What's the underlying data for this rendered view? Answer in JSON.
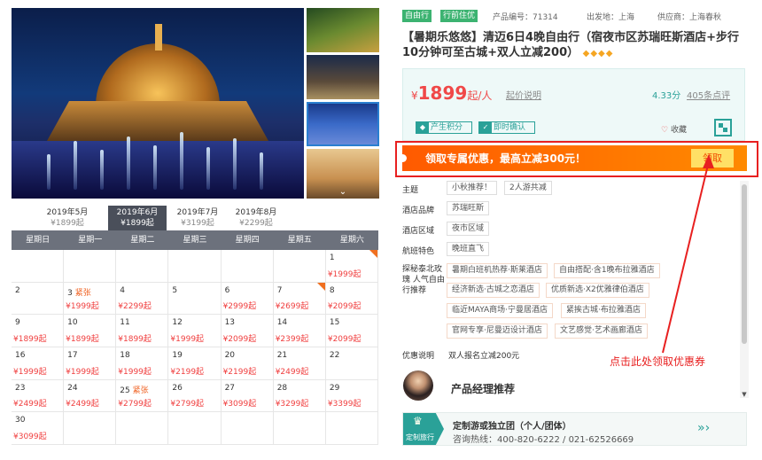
{
  "gallery": {
    "main_image": "resort-night-fountain-photo",
    "thumbnails": [
      "garden-pavilion-photo",
      "night-street-photo",
      "blue-night-palace-photo",
      "temple-pagoda-photo"
    ],
    "scroll_icon": "chevron-down-icon"
  },
  "calendar": {
    "months": [
      {
        "label": "2019年5月",
        "price": "¥1899起",
        "active": false
      },
      {
        "label": "2019年6月",
        "price": "¥1899起",
        "active": true
      },
      {
        "label": "2019年7月",
        "price": "¥3199起",
        "active": false
      },
      {
        "label": "2019年8月",
        "price": "¥2299起",
        "active": false
      }
    ],
    "weekdays": [
      "星期日",
      "星期一",
      "星期二",
      "星期三",
      "星期四",
      "星期五",
      "星期六"
    ],
    "weeks": [
      [
        null,
        null,
        null,
        null,
        null,
        null,
        {
          "day": "1",
          "price": "¥1999起",
          "corner": true
        }
      ],
      [
        {
          "day": "2",
          "price": ""
        },
        {
          "day": "3",
          "tag": "紧张",
          "price": "¥1999起"
        },
        {
          "day": "4",
          "price": "¥2299起"
        },
        {
          "day": "5",
          "price": ""
        },
        {
          "day": "6",
          "price": "¥2999起"
        },
        {
          "day": "7",
          "price": "¥2699起",
          "corner": true
        },
        {
          "day": "8",
          "price": "¥2099起"
        }
      ],
      [
        {
          "day": "9",
          "price": "¥1899起"
        },
        {
          "day": "10",
          "price": "¥1899起"
        },
        {
          "day": "11",
          "price": "¥1899起"
        },
        {
          "day": "12",
          "price": "¥1999起"
        },
        {
          "day": "13",
          "price": "¥2099起"
        },
        {
          "day": "14",
          "price": "¥2399起"
        },
        {
          "day": "15",
          "price": "¥2099起"
        }
      ],
      [
        {
          "day": "16",
          "price": "¥1999起"
        },
        {
          "day": "17",
          "price": "¥1999起"
        },
        {
          "day": "18",
          "price": "¥1999起"
        },
        {
          "day": "19",
          "price": "¥2199起"
        },
        {
          "day": "20",
          "price": "¥2199起"
        },
        {
          "day": "21",
          "price": "¥2499起"
        },
        {
          "day": "22",
          "price": ""
        }
      ],
      [
        {
          "day": "23",
          "price": "¥2499起"
        },
        {
          "day": "24",
          "price": "¥2499起"
        },
        {
          "day": "25",
          "tag": "紧张",
          "price": "¥2799起"
        },
        {
          "day": "26",
          "price": "¥2799起"
        },
        {
          "day": "27",
          "price": "¥3099起"
        },
        {
          "day": "28",
          "price": "¥3299起"
        },
        {
          "day": "29",
          "price": "¥3399起"
        }
      ],
      [
        {
          "day": "30",
          "price": "¥3099起"
        },
        null,
        null,
        null,
        null,
        null,
        null
      ]
    ]
  },
  "product": {
    "badges": [
      "自由行",
      "行前住优"
    ],
    "code": "产品编号：71314",
    "departure": "出发地：上海",
    "supplier": "供应商：上海春秋",
    "title": "【暑期乐悠悠】清迈6日4晚自由行（宿夜市区苏瑞旺斯酒店+步行10分钟可至古城+双人立减200）",
    "stars": "◆◆◆◆"
  },
  "price": {
    "currency": "¥",
    "amount": "1899",
    "unit": "起/人",
    "explain": "起价说明",
    "score": "4.33分",
    "reviews": "405条点评",
    "chip1": "产生积分",
    "chip2": "即时确认",
    "favorite": "收藏",
    "favorite_icon": "heart-icon",
    "qr_icon": "qr-code-icon"
  },
  "promo": {
    "text": "领取专属优惠，最高立减300元！",
    "button": "领取"
  },
  "attrs": {
    "theme_label": "主题",
    "theme_tags": [
      "小秋推荐！",
      "2人游共减"
    ],
    "brand_label": "酒店品牌",
    "brand_tags": [
      "苏瑞旺斯"
    ],
    "area_label": "酒店区域",
    "area_tags": [
      "夜市区域"
    ],
    "flight_label": "航班特色",
    "flight_tags": [
      "晚班直飞"
    ],
    "recommend_label": "探秘泰北玫瑰 人气自由行推荐",
    "recommend_tags": [
      "暑期白班机热荐·斯莱酒店",
      "自由搭配·含1晚布拉雅酒店",
      "经济新选·古城之恋酒店",
      "优质新选·X2优雅律伯酒店",
      "临近MAYA商场·宁曼居酒店",
      "紧挨古城·布拉雅酒店",
      "官网专享·尼曼迈设计酒店",
      "文艺感觉·艺术画廊酒店"
    ],
    "promo_label": "优惠说明",
    "promo_value": "双人报名立减200元"
  },
  "annotation": "点击此处领取优惠券",
  "manager": {
    "title": "产品经理推荐"
  },
  "banner": {
    "icon_label": "定制旅行",
    "title": "定制游或独立团（个人/团体）",
    "phone": "咨询热线：400-820-6222 / 021-62526669",
    "arrow": "»›"
  },
  "colors": {
    "accent": "#2aa198",
    "price": "#f04848",
    "promo": "#ff6a00",
    "annotation": "#e82020"
  }
}
